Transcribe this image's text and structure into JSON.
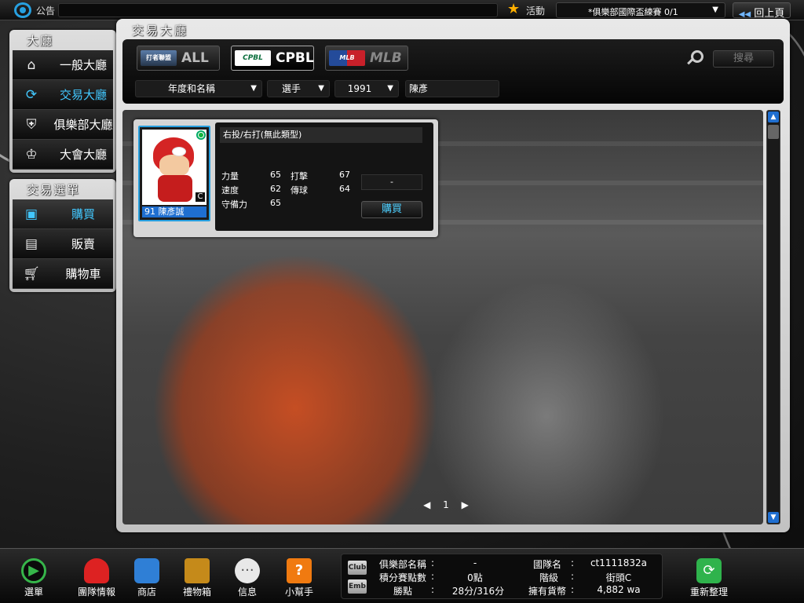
{
  "topbar": {
    "notice_label": "公告",
    "event_label": "活動",
    "event_value": "*俱樂部國際盃練賽 0/1",
    "back_label": "回上頁"
  },
  "sidebar": {
    "lobby_title": "大廳",
    "lobby_items": [
      {
        "label": "一般大廳",
        "icon": "home-icon"
      },
      {
        "label": "交易大廳",
        "icon": "refresh-icon"
      },
      {
        "label": "俱樂部大廳",
        "icon": "club-shield-icon"
      },
      {
        "label": "大會大廳",
        "icon": "trophy-icon"
      }
    ],
    "trade_title": "交易選單",
    "trade_items": [
      {
        "label": "購買",
        "icon": "buy-box-icon"
      },
      {
        "label": "販賣",
        "icon": "sell-card-icon"
      },
      {
        "label": "購物車",
        "icon": "cart-icon"
      }
    ]
  },
  "main": {
    "title": "交易大廳",
    "tabs": [
      {
        "logo": "打者聯盟",
        "label": "ALL"
      },
      {
        "logo": "CPBL",
        "label": "CPBL"
      },
      {
        "logo": "MLB",
        "label": "MLB"
      }
    ],
    "search_label": "搜尋",
    "filters": {
      "sort": "年度和名稱",
      "type": "選手",
      "year": "1991",
      "name": "陳彥"
    }
  },
  "card": {
    "portrait_label": "91 陳彥誠",
    "grade": "C",
    "hand": "右投/右打(無此類型)",
    "stats": [
      {
        "label": "力量",
        "value": "65"
      },
      {
        "label": "速度",
        "value": "62"
      },
      {
        "label": "守備力",
        "value": "65"
      },
      {
        "label": "打擊",
        "value": "67"
      },
      {
        "label": "傳球",
        "value": "64"
      }
    ],
    "offer": "-",
    "buy_label": "購買"
  },
  "pager": {
    "page": "1",
    "prev": "◀",
    "next": "▶"
  },
  "bottom": {
    "menu": "選單",
    "team": "團隊情報",
    "shop": "商店",
    "gift": "禮物箱",
    "msg": "信息",
    "help": "小幫手",
    "refresh": "重新整理",
    "club_tag": "Club",
    "emb_tag": "Emb",
    "club_name_label": "俱樂部名稱",
    "club_name_value": "-",
    "points_label": "積分賽點數",
    "points_value": "0點",
    "wins_label": "勝點",
    "wins_value": "28分/316分",
    "team_name_label": "國隊名",
    "team_name_value": "ct1111832a",
    "rank_label": "階級",
    "rank_value": "街頭C",
    "money_label": "擁有貨幣",
    "money_value": "4,882 wa",
    "colon": ":"
  },
  "colors": {
    "accent_blue": "#42c8ff",
    "select_blue": "#1f6fd1",
    "green": "#36b54a"
  }
}
